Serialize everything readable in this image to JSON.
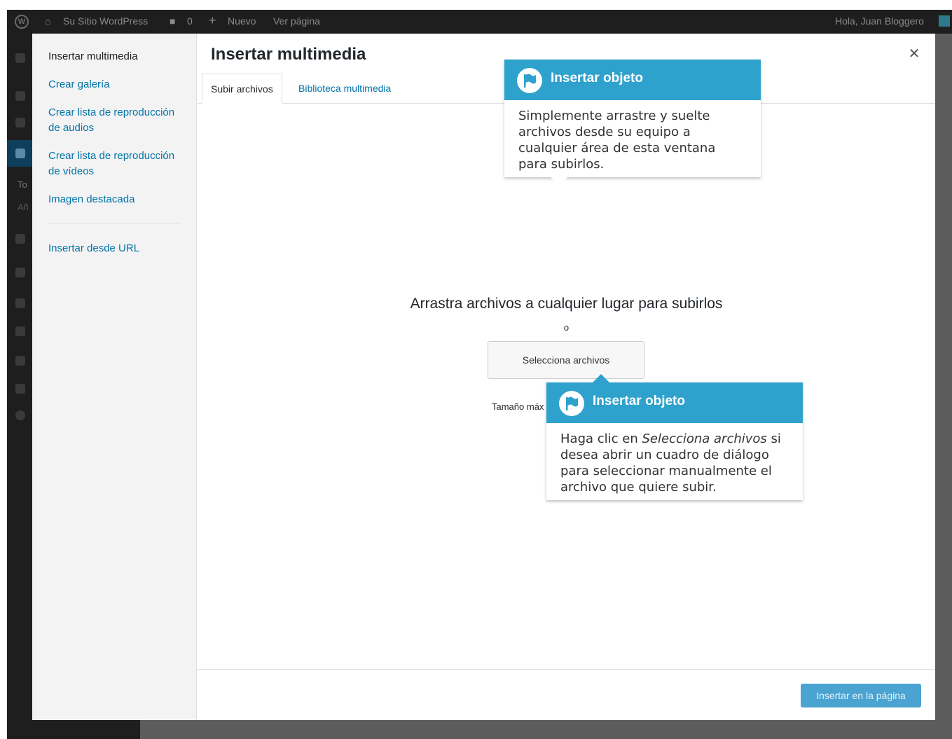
{
  "adminbar": {
    "site_name": "Su Sitio WordPress",
    "comments_count": "0",
    "new_label": "Nuevo",
    "view_page": "Ver página",
    "greeting": "Hola, Juan Bloggero"
  },
  "admin_sidebar": {
    "partial_text_1": "To",
    "partial_text_2": "Añ"
  },
  "media_menu": {
    "items": [
      {
        "label": "Insertar multimedia"
      },
      {
        "label": "Crear galería"
      },
      {
        "label": "Crear lista de reproducción de audios"
      },
      {
        "label": "Crear lista de reproducción de vídeos"
      },
      {
        "label": "Imagen destacada"
      },
      {
        "label": "Insertar desde URL"
      }
    ]
  },
  "modal": {
    "title": "Insertar multimedia",
    "close_icon": "close-icon",
    "tabs": [
      {
        "label": "Subir archivos"
      },
      {
        "label": "Biblioteca multimedia"
      }
    ]
  },
  "uploader": {
    "drop_text": "Arrastra archivos a cualquier lugar para subirlos",
    "or_text": "o",
    "select_button": "Selecciona archivos",
    "max_size_partial": "Tamaño máx"
  },
  "footer": {
    "insert_button": "Insertar en la página"
  },
  "pointers": [
    {
      "heading": "Insertar objeto",
      "body": "Simplemente arrastre y suelte archivos desde su equipo a cualquier área de esta ventana para subirlos."
    },
    {
      "heading": "Insertar objeto",
      "body_before": "Haga clic en ",
      "body_em": "Selecciona archivos",
      "body_after": " si desea abrir un cuadro de diálogo para seleccionar manualmente el archivo que quiere subir."
    }
  ],
  "colors": {
    "accent": "#2ea2cc",
    "link": "#0073aa",
    "adminbar": "#1e1e1e",
    "insert_button_disabled": "#4aa3d0"
  }
}
